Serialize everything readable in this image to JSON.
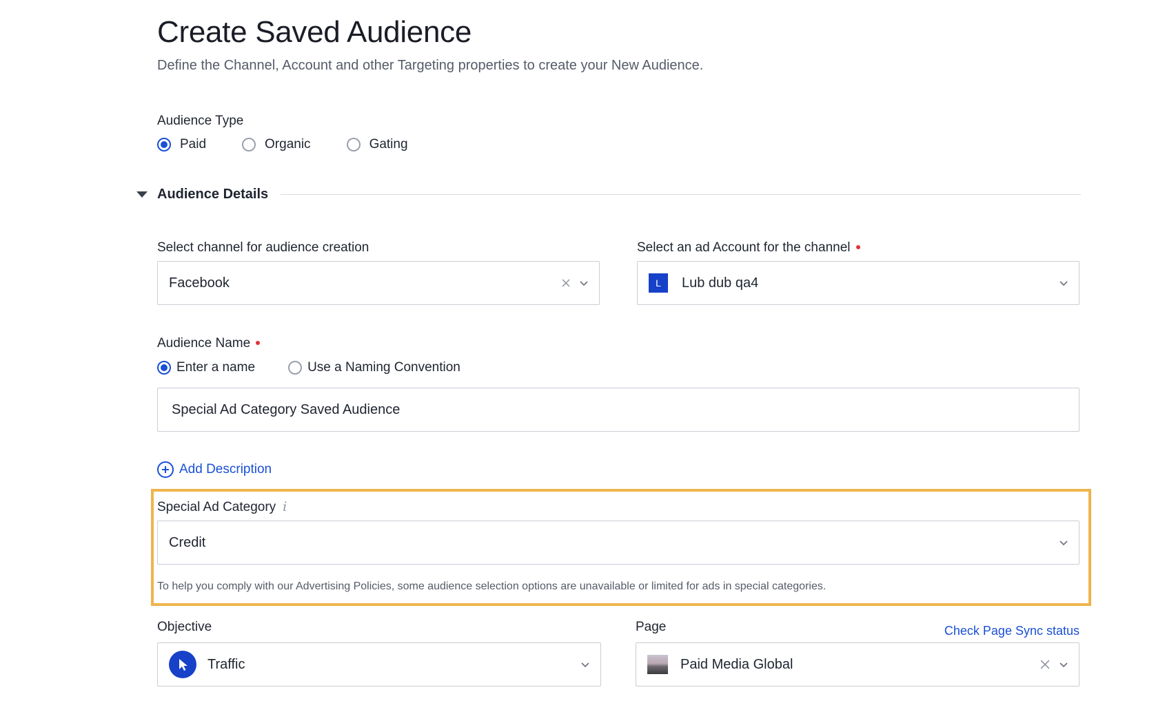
{
  "header": {
    "title": "Create Saved Audience",
    "subtitle": "Define the Channel, Account and other Targeting properties to create your New Audience."
  },
  "audience_type": {
    "label": "Audience Type",
    "options": [
      {
        "label": "Paid",
        "selected": true
      },
      {
        "label": "Organic",
        "selected": false
      },
      {
        "label": "Gating",
        "selected": false
      }
    ]
  },
  "audience_details": {
    "title": "Audience Details",
    "channel": {
      "label": "Select channel for audience creation",
      "value": "Facebook"
    },
    "ad_account": {
      "label": "Select an ad Account for the channel",
      "badge": "L",
      "value": "Lub dub qa4"
    },
    "audience_name": {
      "label": "Audience Name",
      "options": [
        {
          "label": "Enter a name",
          "selected": true
        },
        {
          "label": "Use a Naming Convention",
          "selected": false
        }
      ],
      "value": "Special Ad Category Saved Audience"
    },
    "add_description": "Add Description",
    "special_ad_category": {
      "label": "Special Ad Category",
      "info_glyph": "i",
      "value": "Credit",
      "helper": "To help you comply with our Advertising Policies, some audience selection options are unavailable or limited for ads in special categories."
    },
    "objective": {
      "label": "Objective",
      "value": "Traffic"
    },
    "page": {
      "label": "Page",
      "sync_link": "Check Page Sync status",
      "value": "Paid Media Global"
    }
  },
  "colors": {
    "accent": "#1a4fd6",
    "highlight": "#f0b44c",
    "required": "#e0313a",
    "border": "#c9cdd4"
  }
}
